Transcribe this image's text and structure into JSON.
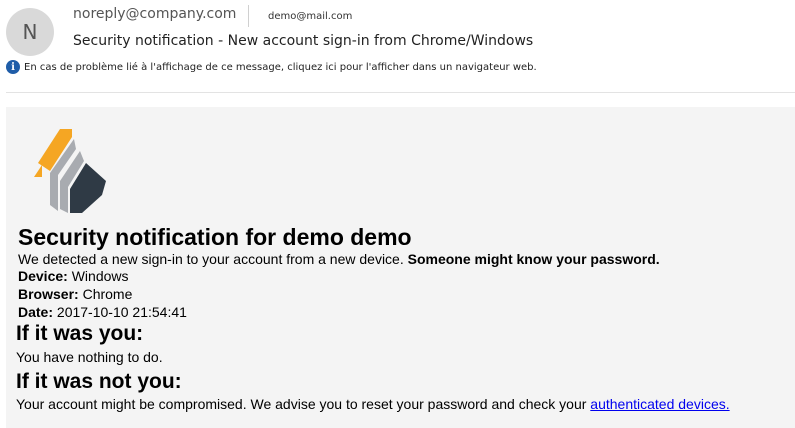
{
  "header": {
    "avatar_initial": "N",
    "from": "noreply@company.com",
    "to": "demo@mail.com",
    "subject": "Security notification - New account sign-in from Chrome/Windows",
    "info_icon": "info-icon",
    "info_text": "En cas de problème lié à l'affichage de ce message, cliquez ici pour l'afficher dans un navigateur web."
  },
  "email": {
    "logo_icon": "company-logo",
    "title": "Security notification for demo demo",
    "intro": "We detected a new sign-in to your account from a new device.",
    "intro_bold": "Someone might know your password.",
    "device_label": "Device:",
    "device_value": "Windows",
    "browser_label": "Browser:",
    "browser_value": "Chrome",
    "date_label": "Date:",
    "date_value": "2017-10-10 21:54:41",
    "if_you_heading": "If it was you:",
    "if_you_text": "You have nothing to do.",
    "if_not_heading": "If it was not you:",
    "if_not_text": "Your account might be compromised. We advise you to reset your password and check your",
    "link_text": "authenticated devices."
  },
  "colors": {
    "logo_orange": "#f5a623",
    "logo_gray": "#a8abb0",
    "logo_dark": "#2f3a45",
    "info_blue": "#1f5da8",
    "link": "#0000ee",
    "body_bg": "#f4f4f4"
  }
}
